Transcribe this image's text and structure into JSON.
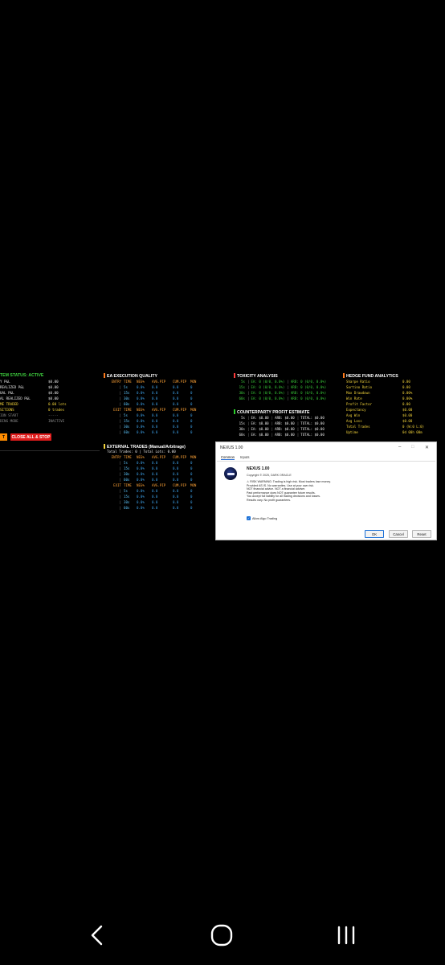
{
  "system": {
    "status": "TEM STATUS: ACTIVE",
    "rows": [
      {
        "label": "Y P&L",
        "value": "$0.00",
        "color": "w"
      },
      {
        "label": "REALIZED P&L",
        "value": "$0.00",
        "color": "w"
      },
      {
        "label": "UAL P&L",
        "value": "$0.00",
        "color": "w"
      },
      {
        "label": "AL REALIZED P&L",
        "value": "$0.00",
        "color": "w"
      },
      {
        "label": "ME TRADED",
        "value": "0.00 lots",
        "color": "y"
      },
      {
        "label": "SITIONS",
        "value": "0 trades",
        "color": "y"
      },
      {
        "label": "ION START",
        "value": "-----",
        "color": "gr"
      },
      {
        "label": "DING MODE",
        "value": "INACTIVE",
        "color": "gr"
      }
    ],
    "btn_left": "T",
    "btn_close": "CLOSE ALL & STOP"
  },
  "ea": {
    "title": "EA EXECUTION QUALITY",
    "cols": [
      "TIME",
      "NEG%",
      "AVG.PIP",
      "CUM.PIP",
      "MON"
    ],
    "entry_label": "ENTRY",
    "exit_label": "EXIT",
    "entry_rows": [
      [
        "5s",
        "0.0%",
        "0.0",
        "0.0",
        "0"
      ],
      [
        "15s",
        "0.0%",
        "0.0",
        "0.0",
        "0"
      ],
      [
        "30s",
        "0.0%",
        "0.0",
        "0.0",
        "0"
      ],
      [
        "60s",
        "0.0%",
        "0.0",
        "0.0",
        "0"
      ]
    ],
    "exit_rows": [
      [
        "5s",
        "0.0%",
        "0.0",
        "0.0",
        "0"
      ],
      [
        "15s",
        "0.0%",
        "0.0",
        "0.0",
        "0"
      ],
      [
        "30s",
        "0.0%",
        "0.0",
        "0.0",
        "0"
      ],
      [
        "60s",
        "0.0%",
        "0.0",
        "0.0",
        "0"
      ]
    ]
  },
  "ext": {
    "title": "EXTERNAL TRADES (Manual/Arbitrage)",
    "summary": "Total Trades: 0 | Total Lots: 0.00",
    "entry_rows": [
      [
        "5s",
        "0.0%",
        "0.0",
        "0.0",
        "0"
      ],
      [
        "15s",
        "0.0%",
        "0.0",
        "0.0",
        "0"
      ],
      [
        "30s",
        "0.0%",
        "0.0",
        "0.0",
        "0"
      ],
      [
        "60s",
        "0.0%",
        "0.0",
        "0.0",
        "0"
      ]
    ],
    "exit_rows": [
      [
        "5s",
        "0.0%",
        "0.0",
        "0.0",
        "0"
      ],
      [
        "15s",
        "0.0%",
        "0.0",
        "0.0",
        "0"
      ],
      [
        "30s",
        "0.0%",
        "0.0",
        "0.0",
        "0"
      ],
      [
        "60s",
        "0.0%",
        "0.0",
        "0.0",
        "0"
      ]
    ]
  },
  "toxicity": {
    "title": "TOXICITY ANALYSIS",
    "rows": [
      [
        "5s",
        "EA: 0 (0/0, 0.0%)",
        "ARB: 0 (0/0, 0.0%)"
      ],
      [
        "15s",
        "EA: 0 (0/0, 0.0%)",
        "ARB: 0 (0/0, 0.0%)"
      ],
      [
        "30s",
        "EA: 0 (0/0, 0.0%)",
        "ARB: 0 (0/0, 0.0%)"
      ],
      [
        "60s",
        "EA: 0 (0/0, 0.0%)",
        "ARB: 0 (0/0, 0.0%)"
      ]
    ]
  },
  "counterparty": {
    "title": "COUNTERPARTY PROFIT ESTIMATE",
    "rows": [
      [
        "5s",
        "EA: $0.00",
        "ARB: $0.00",
        "TOTAL: $0.00"
      ],
      [
        "15s",
        "EA: $0.00",
        "ARB: $0.00",
        "TOTAL: $0.00"
      ],
      [
        "30s",
        "EA: $0.00",
        "ARB: $0.00",
        "TOTAL: $0.00"
      ],
      [
        "60s",
        "EA: $0.00",
        "ARB: $0.00",
        "TOTAL: $0.00"
      ]
    ]
  },
  "hedge": {
    "title": "HEDGE FUND ANALYTICS",
    "rows": [
      [
        "Sharpe Ratio",
        "0.00"
      ],
      [
        "Sortino Ratio",
        "0.00"
      ],
      [
        "Max Drawdown",
        "0.00%"
      ],
      [
        "Win Rate",
        "0.00%"
      ],
      [
        "Profit Factor",
        "0.00"
      ],
      [
        "Expectancy",
        "$0.00"
      ],
      [
        "Avg Win",
        "$0.00"
      ],
      [
        "Avg Loss",
        "$0.00"
      ],
      [
        "Total Trades",
        "0 (W:0 L:0)"
      ],
      [
        "Uptime",
        "0d 00h 00m"
      ]
    ]
  },
  "dialog": {
    "window_title": "NEXUS 1.00",
    "tabs": [
      "Common",
      "Inputs"
    ],
    "app_name": "NEXUS 1.00",
    "copyright": "Copyright © 2025, DARK ORACLE",
    "warning_lines": [
      "⚠ RISK WARNING: Trading is high risk. Most traders lose money.",
      "Provided AS IS. No warranties. Use at your own risk.",
      "NOT financial advice. NOT a financial adviser.",
      "Past performance does NOT guarantee future results.",
      "You accept full liability for all trading decisions and losses.",
      "Results vary. No profit guarantees."
    ],
    "checkbox_label": "Allow Algo Trading",
    "checkbox_checked": true,
    "ok": "OK",
    "cancel": "Cancel",
    "reset": "Reset",
    "minimize_icon": "–",
    "maximize_icon": "□",
    "close_icon": "✕"
  },
  "colors": {
    "status_green": "#3fd13f",
    "close_btn_red": "#e01b1b",
    "left_btn_orange": "#ff8c00",
    "accent_orange": "#ff7a1a",
    "accent_green": "#2bd12b",
    "accent_yellow": "#f2d33a"
  }
}
